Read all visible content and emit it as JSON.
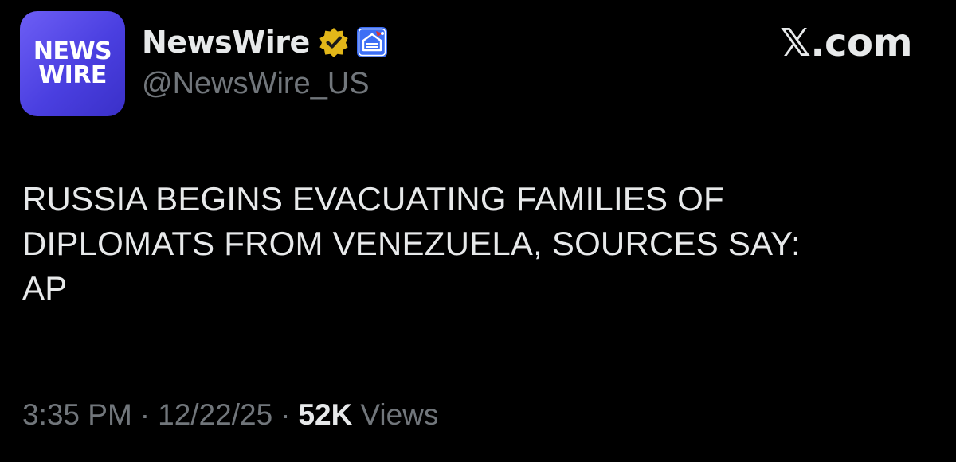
{
  "account": {
    "avatar_line1": "NEWS",
    "avatar_line2": "WIRE",
    "display_name": "NewsWire",
    "handle": "@NewsWire_US",
    "verified_badge": "gold-verified-checkmark-icon",
    "affiliate_badge": "affiliate-badge-icon"
  },
  "watermark": "𝕏.com",
  "tweet": {
    "text": "RUSSIA BEGINS EVACUATING FAMILIES OF\nDIPLOMATS FROM VENEZUELA, SOURCES SAY:\nAP",
    "time": "3:35 PM",
    "separator": "·",
    "date": "12/22/25",
    "views_count": "52K",
    "views_label": "Views"
  },
  "colors": {
    "background": "#000000",
    "primary_text": "#e7e9ea",
    "secondary_text": "#71767b",
    "verified_gold": "#e2b719",
    "affiliate_blue": "#3d6ff5",
    "avatar_purple": "#5a4ef0"
  }
}
